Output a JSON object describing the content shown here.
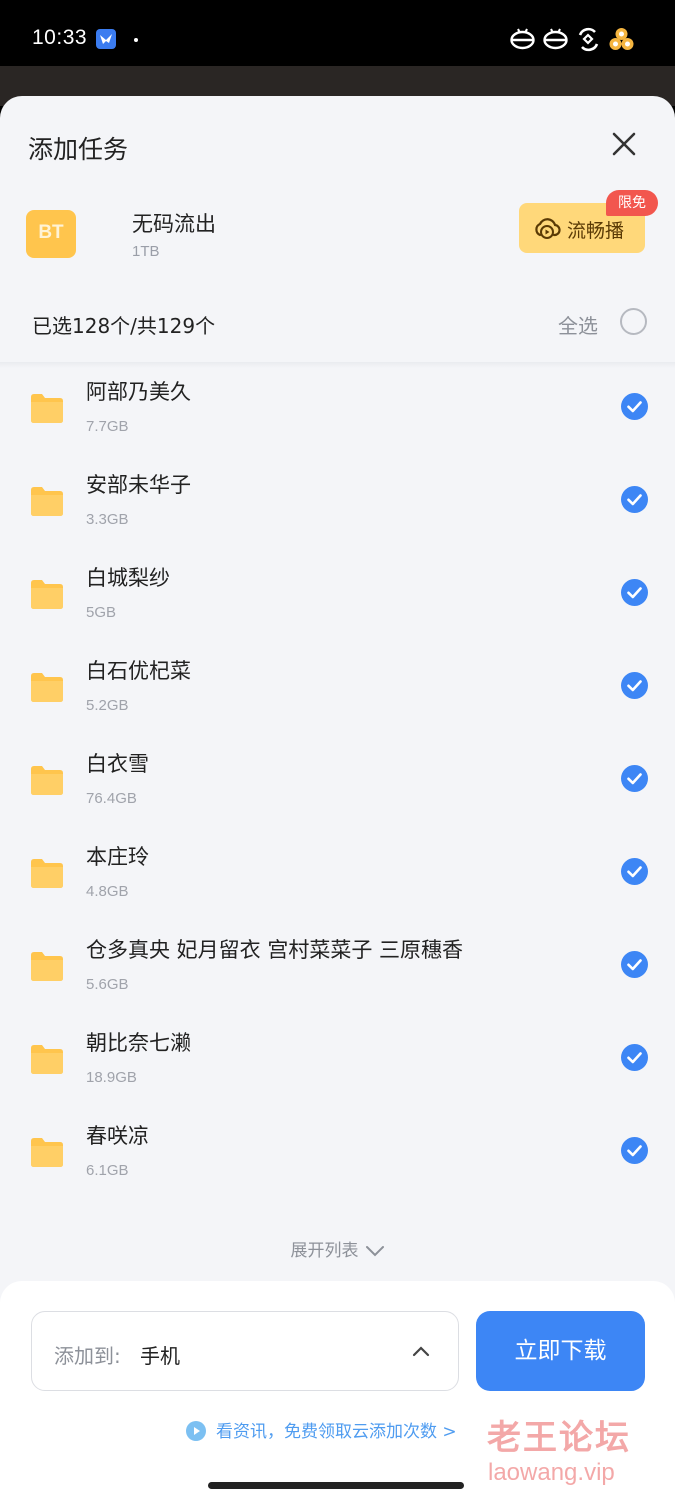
{
  "status_bar": {
    "time": "10:33"
  },
  "sheet": {
    "title": "添加任务",
    "task": {
      "icon_text": "BT",
      "name": "无码流出",
      "size": "1TB"
    },
    "play_button": {
      "label": "流畅播",
      "badge": "限免"
    },
    "selection": {
      "count_text": "已选128个/共129个",
      "select_all_label": "全选"
    },
    "files": [
      {
        "name": "阿部乃美久",
        "size": "7.7GB",
        "checked": true
      },
      {
        "name": "安部未华子",
        "size": "3.3GB",
        "checked": true
      },
      {
        "name": "白城梨纱",
        "size": "5GB",
        "checked": true
      },
      {
        "name": "白石优杞菜",
        "size": "5.2GB",
        "checked": true
      },
      {
        "name": "白衣雪",
        "size": "76.4GB",
        "checked": true
      },
      {
        "name": "本庄玲",
        "size": "4.8GB",
        "checked": true
      },
      {
        "name": "仓多真央 妃月留衣 宫村菜菜子 三原穗香",
        "size": "5.6GB",
        "checked": true
      },
      {
        "name": "朝比奈七濑",
        "size": "18.9GB",
        "checked": true
      },
      {
        "name": "春咲凉",
        "size": "6.1GB",
        "checked": true
      }
    ],
    "expand_label": "展开列表"
  },
  "bottom": {
    "dest_label": "添加到:",
    "dest_value": "手机",
    "download_button": "立即下载",
    "promo_text": "看资讯，免费领取云添加次数 >"
  },
  "watermark": {
    "cn": "老王论坛",
    "en": "laowang.vip"
  },
  "colors": {
    "accent": "#3d86f5",
    "folder": "#ffc54d",
    "badge": "#f2564e",
    "play_bg": "#ffd87a"
  }
}
